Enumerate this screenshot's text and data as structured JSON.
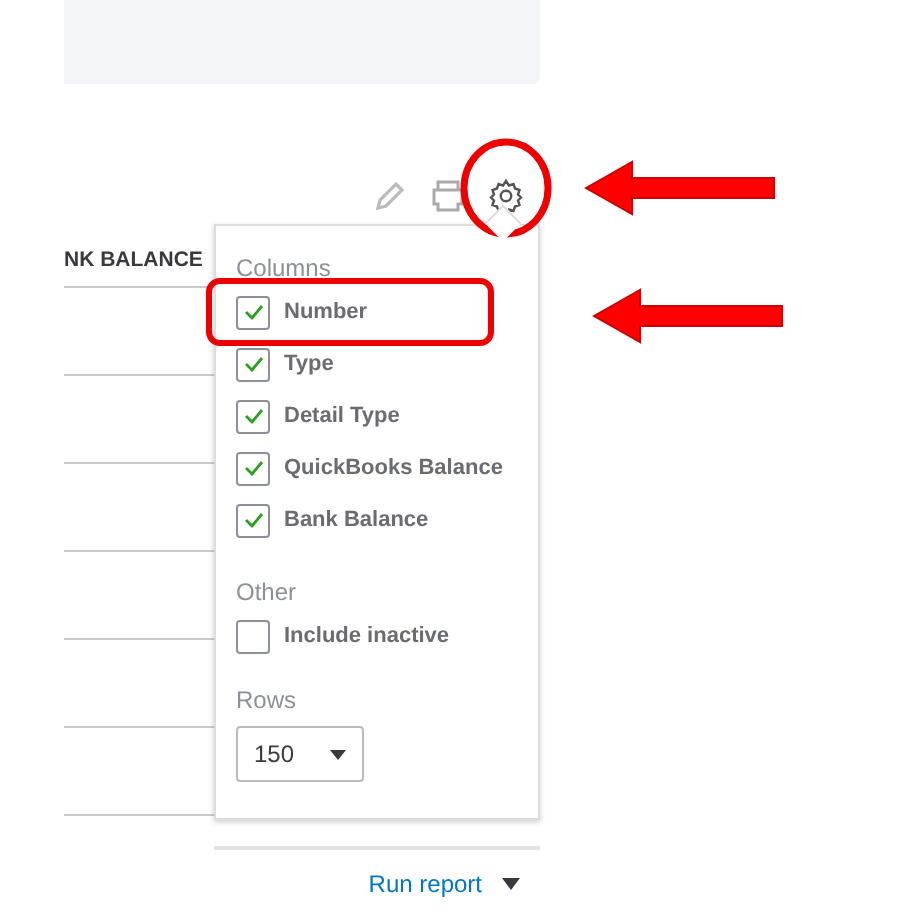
{
  "table": {
    "column_header": "NK BALANCE"
  },
  "settings_popup": {
    "columns_heading": "Columns",
    "columns": [
      {
        "label": "Number",
        "checked": true
      },
      {
        "label": "Type",
        "checked": true
      },
      {
        "label": "Detail Type",
        "checked": true
      },
      {
        "label": "QuickBooks Balance",
        "checked": true
      },
      {
        "label": "Bank Balance",
        "checked": true
      }
    ],
    "other_heading": "Other",
    "other": [
      {
        "label": "Include inactive",
        "checked": false
      }
    ],
    "rows_heading": "Rows",
    "rows_value": "150"
  },
  "footer": {
    "link": "Run report"
  }
}
